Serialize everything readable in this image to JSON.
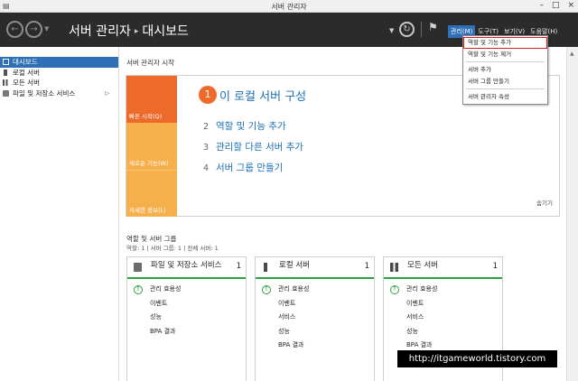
{
  "window": {
    "title": "서버 관리자",
    "buttons": [
      "–",
      "□",
      "×"
    ]
  },
  "header": {
    "breadcrumb_root": "서버 관리자",
    "breadcrumb_separator": "▸",
    "breadcrumb_current": "대시보드",
    "menus": [
      "관리(M)",
      "도구(T)",
      "보기(V)",
      "도움말(H)"
    ],
    "active_menu": "관리(M)"
  },
  "sidebar": {
    "items": [
      {
        "label": "대시보드",
        "icon": "dashboard-icon",
        "active": true
      },
      {
        "label": "로컬 서버",
        "icon": "server-icon"
      },
      {
        "label": "모든 서버",
        "icon": "servers-icon"
      },
      {
        "label": "파일 및 저장소 서비스",
        "icon": "file-storage-icon",
        "has_arrow": true
      }
    ],
    "arrow_glyph": "▷"
  },
  "quick_start": {
    "section_title": "서버 관리자 시작",
    "tiles": [
      "빠른 시작(Q)",
      "새로운 기능(W)",
      "자세한 정보(L)"
    ],
    "main_step": {
      "num": "1",
      "label": "이 로컬 서버 구성"
    },
    "steps": [
      {
        "num": "2",
        "label": "역할 및 기능 추가"
      },
      {
        "num": "3",
        "label": "관리할 다른 서버 추가"
      },
      {
        "num": "4",
        "label": "서버 그룹 만들기"
      }
    ],
    "hide_label": "숨기기"
  },
  "roles": {
    "title": "역할 및 서버 그룹",
    "subtitle": "역할: 1  |  서버 그룹: 1  |  전체 서버: 1",
    "cards": [
      {
        "title": "파일 및 저장소 서비스",
        "count": "1",
        "icon": "file-storage-icon",
        "rows": [
          "관리 효용성",
          "이벤트",
          "성능",
          "BPA 결과"
        ]
      },
      {
        "title": "로컬 서버",
        "count": "1",
        "icon": "server-icon",
        "rows": [
          "관리 효용성",
          "이벤트",
          "서비스",
          "성능",
          "BPA 결과"
        ]
      },
      {
        "title": "모든 서버",
        "count": "1",
        "icon": "servers-icon",
        "rows": [
          "관리 효용성",
          "이벤트",
          "서비스",
          "성능",
          "BPA 결과"
        ]
      }
    ]
  },
  "manage_menu": {
    "items": [
      "역할 및 기능 추가",
      "역할 및 기능 제거",
      "서버 추가",
      "서버 그룹 만들기",
      "서버 관리자 속성"
    ],
    "highlighted": "역할 및 기능 추가"
  },
  "watermark": "http://itgameworld.tistory.com",
  "colors": {
    "header_bg": "#2b2b2b",
    "accent_blue": "#2f6fb6",
    "orange": "#ee6a2a",
    "light_orange": "#f6b04b",
    "status_green": "#2ea043",
    "highlight_red": "#d32020"
  }
}
